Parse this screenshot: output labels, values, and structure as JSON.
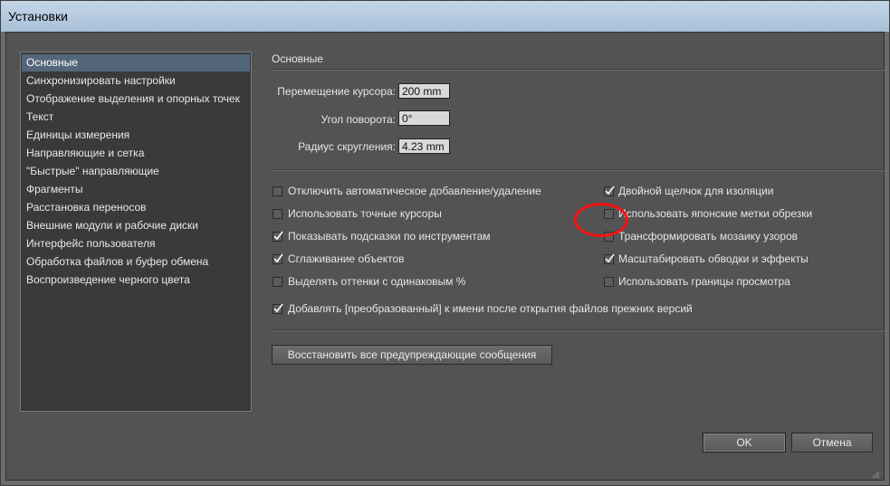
{
  "window": {
    "title": "Установки"
  },
  "sidebar": {
    "items": [
      {
        "label": "Основные",
        "selected": true
      },
      {
        "label": "Синхронизировать настройки"
      },
      {
        "label": "Отображение выделения и опорных точек"
      },
      {
        "label": "Текст"
      },
      {
        "label": "Единицы измерения"
      },
      {
        "label": "Направляющие и сетка"
      },
      {
        "label": "\"Быстрые\" направляющие"
      },
      {
        "label": "Фрагменты"
      },
      {
        "label": "Расстановка переносов"
      },
      {
        "label": "Внешние модули и рабочие диски"
      },
      {
        "label": "Интерфейс пользователя"
      },
      {
        "label": "Обработка файлов и буфер обмена"
      },
      {
        "label": "Воспроизведение черного цвета"
      }
    ]
  },
  "main": {
    "section_title": "Основные",
    "fields": [
      {
        "label": "Перемещение курсора:",
        "value": "200 mm"
      },
      {
        "label": "Угол поворота:",
        "value": "0°"
      },
      {
        "label": "Радиус скругления:",
        "value": "4.23 mm"
      }
    ],
    "checkboxes_left": [
      {
        "label": "Отключить автоматическое добавление/удаление",
        "checked": false
      },
      {
        "label": "Использовать точные курсоры",
        "checked": false
      },
      {
        "label": "Показывать подсказки по инструментам",
        "checked": true
      },
      {
        "label": "Сглаживание объектов",
        "checked": true
      },
      {
        "label": "Выделять оттенки с одинаковым %",
        "checked": false
      }
    ],
    "checkboxes_right": [
      {
        "label": "Двойной щелчок для изоляции",
        "checked": true
      },
      {
        "label": "Использовать японские метки обрезки",
        "checked": false
      },
      {
        "label": "Трансформировать мозаику узоров",
        "checked": false
      },
      {
        "label": "Масштабировать обводки и эффекты",
        "checked": true
      },
      {
        "label": "Использовать границы просмотра",
        "checked": false
      }
    ],
    "checkbox_wide": {
      "label": "Добавлять [преобразованный] к имени после открытия файлов прежних версий",
      "checked": true
    },
    "reset_button": "Восстановить все предупреждающие сообщения"
  },
  "footer": {
    "ok": "OK",
    "cancel": "Отмена"
  },
  "colors": {
    "highlight": "#ff1010",
    "selected": "#53667a"
  }
}
